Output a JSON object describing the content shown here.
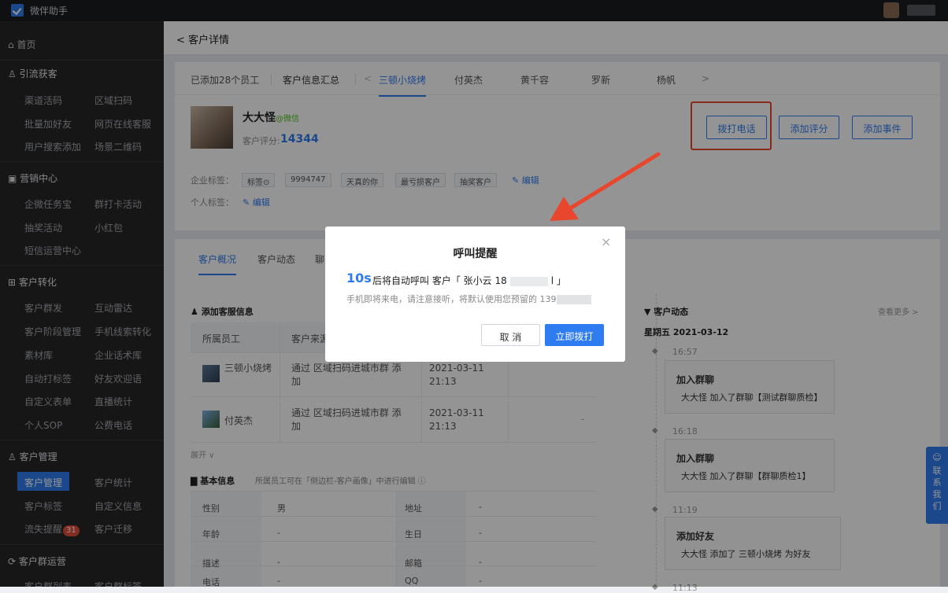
{
  "app": {
    "name": "微伴助手"
  },
  "sidebar": {
    "home": "首页",
    "groups": [
      {
        "title": "引流获客",
        "items": [
          "渠道活码",
          "区域扫码",
          "批量加好友",
          "网页在线客服",
          "用户搜索添加",
          "场景二维码"
        ]
      },
      {
        "title": "营销中心",
        "items": [
          "企微任务宝",
          "群打卡活动",
          "抽奖活动",
          "小红包",
          "短信运营中心"
        ]
      },
      {
        "title": "客户转化",
        "items": [
          "客户群发",
          "互动雷达",
          "客户阶段管理",
          "手机线索转化",
          "素材库",
          "企业话术库",
          "自动打标签",
          "好友欢迎语",
          "自定义表单",
          "直播统计",
          "个人SOP",
          "公费电话"
        ]
      },
      {
        "title": "客户管理",
        "items": [
          "客户管理",
          "客户统计",
          "客户标签",
          "自定义信息",
          "流失提醒",
          "客户迁移"
        ],
        "badge": "31"
      },
      {
        "title": "客户群运营",
        "items": [
          "客户群列表",
          "客户群标签"
        ]
      }
    ]
  },
  "page": {
    "title": "客户详情"
  },
  "staff_tabs": {
    "added": "已添加28个员工",
    "summary": "客户信息汇总",
    "prev": "<",
    "next": ">",
    "names": [
      "三顿小烧烤",
      "付英杰",
      "黄千容",
      "罗新",
      "杨帆"
    ]
  },
  "customer": {
    "name": "大大怪",
    "source": "@微信",
    "score_label": "客户评分:",
    "score": "14344",
    "company_tags_label": "企业标签：",
    "personal_tags_label": "个人标签：",
    "tags": [
      "标签⊙",
      "9994747",
      "天真的你",
      "最亏损客户",
      "抽奖客户"
    ],
    "edit": "编辑"
  },
  "actions": {
    "call": "拨打电话",
    "rate": "添加评分",
    "event": "添加事件"
  },
  "detail_tabs": [
    "客户概况",
    "客户动态",
    "聊"
  ],
  "service": {
    "title": "添加客服信息",
    "headers": [
      "所属员工",
      "客户来源"
    ],
    "rows": [
      {
        "name": "三顿小烧烤",
        "source": "通过 区域扫码进城市群 添加",
        "time": "2021-03-11 21:13",
        "extra": ""
      },
      {
        "name": "付英杰",
        "source": "通过 区域扫码进城市群 添加",
        "time": "2021-03-11 21:13",
        "extra": "-"
      }
    ],
    "expand": "展开 ∨"
  },
  "basic": {
    "title": "基本信息",
    "note": "所属员工可在「侧边栏-客户画像」中进行编辑 ⓘ",
    "fields": [
      {
        "label": "性别",
        "value": "男",
        "label2": "地址",
        "value2": "-"
      },
      {
        "label": "年龄",
        "value": "-",
        "label2": "生日",
        "value2": "-"
      },
      {
        "label": "描述",
        "value": "-",
        "label2": "邮箱",
        "value2": "-"
      },
      {
        "label": "电话",
        "value": "-",
        "label2": "QQ",
        "value2": "-"
      }
    ]
  },
  "activity": {
    "title": "客户动态",
    "more": "查看更多 >",
    "date": "星期五 2021-03-12",
    "events": [
      {
        "time": "16:57",
        "title": "加入群聊",
        "actor": "大大怪",
        "text": "加入了群聊【测试群聊质检】"
      },
      {
        "time": "16:18",
        "title": "加入群聊",
        "actor": "大大怪",
        "text": "加入了群聊【群聊质检1】"
      },
      {
        "time": "11:19",
        "title": "添加好友",
        "actor": "大大怪",
        "text": "添加了 三顿小烧烤 为好友"
      },
      {
        "time": "11:13",
        "title": "",
        "actor": "",
        "text": ""
      }
    ]
  },
  "contact_us": "联系我们",
  "modal": {
    "title": "呼叫提醒",
    "close": "×",
    "seconds": "10s",
    "line1_pre": "后将自动呼叫  客户「 张小云 18",
    "line1_post": "l 」",
    "line2": "手机即将来电，请注意接听，将默认使用您预留的 139",
    "cancel": "取 消",
    "confirm": "立即拨打"
  },
  "colors": {
    "accent": "#2f7cf0",
    "highlight": "#e8472e",
    "sidebar": "#262729"
  }
}
